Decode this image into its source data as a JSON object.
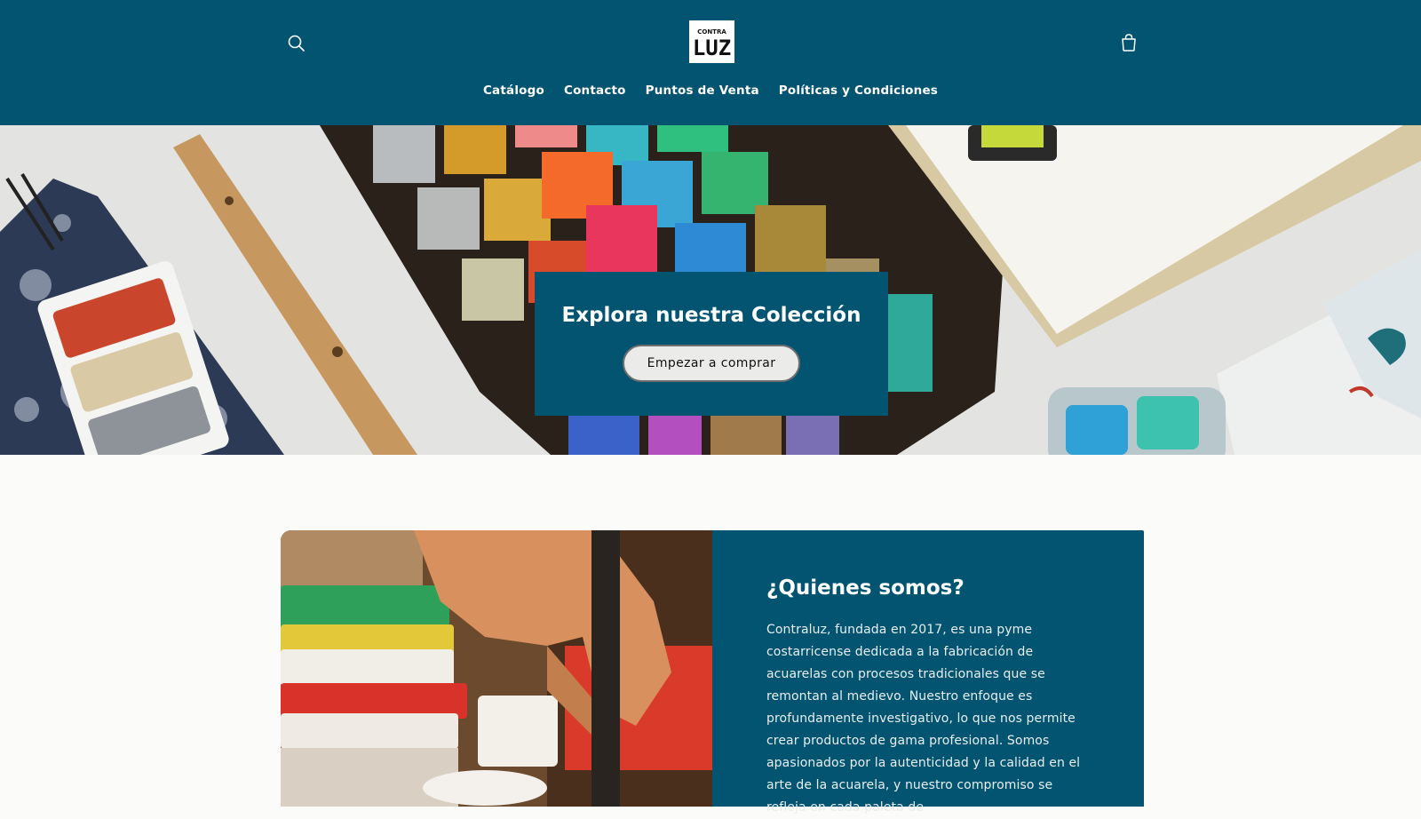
{
  "brand": {
    "logo_top": "CONTRA",
    "logo_main": "LUZ"
  },
  "header": {
    "search_icon": "search-icon",
    "cart_icon": "cart-icon",
    "nav": [
      "Catálogo",
      "Contacto",
      "Puntos de Venta",
      "Políticas y Condiciones"
    ]
  },
  "hero": {
    "title": "Explora nuestra Colección",
    "button": "Empezar a comprar"
  },
  "about": {
    "title": "¿Quienes somos?",
    "text": "Contraluz, fundada en 2017, es una pyme costarricense dedicada a la fabricación de acuarelas con procesos tradicionales que se remontan al medievo. Nuestro enfoque es profundamente investigativo, lo que nos permite crear productos de gama profesional. Somos apasionados por la autenticidad y la calidad en el arte de la acuarela, y nuestro compromiso se refleja en cada paleta de"
  },
  "colors": {
    "brand": "#035470",
    "page_bg": "#fbfbf9",
    "button_bg": "#ebebea"
  }
}
